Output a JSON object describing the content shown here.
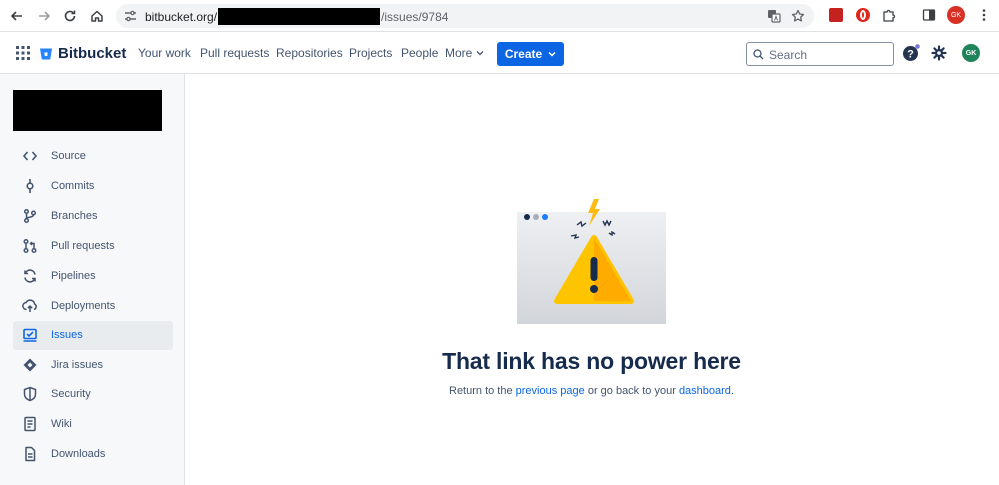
{
  "browser": {
    "url_host": "bitbucket.org/",
    "url_path": "/issues/9784",
    "avatar_initials": "GK"
  },
  "topnav": {
    "logo": "Bitbucket",
    "items": [
      "Your work",
      "Pull requests",
      "Repositories",
      "Projects",
      "People"
    ],
    "more_label": "More",
    "create_label": "Create",
    "search_placeholder": "Search",
    "avatar_initials": "GK",
    "accent": "#0c66e4"
  },
  "sidebar": {
    "items": [
      {
        "label": "Source",
        "icon": "code-icon"
      },
      {
        "label": "Commits",
        "icon": "commit-icon"
      },
      {
        "label": "Branches",
        "icon": "branch-icon"
      },
      {
        "label": "Pull requests",
        "icon": "pull-request-icon"
      },
      {
        "label": "Pipelines",
        "icon": "pipelines-icon"
      },
      {
        "label": "Deployments",
        "icon": "deployments-icon"
      },
      {
        "label": "Issues",
        "icon": "issues-icon",
        "active": true
      },
      {
        "label": "Jira issues",
        "icon": "jira-icon"
      },
      {
        "label": "Security",
        "icon": "shield-icon"
      },
      {
        "label": "Wiki",
        "icon": "wiki-icon"
      },
      {
        "label": "Downloads",
        "icon": "downloads-icon"
      }
    ]
  },
  "main": {
    "title": "That link has no power here",
    "msg_before": "Return to the ",
    "link_previous": "previous page",
    "msg_middle": " or go back to your ",
    "link_dashboard": "dashboard",
    "msg_after": "."
  }
}
